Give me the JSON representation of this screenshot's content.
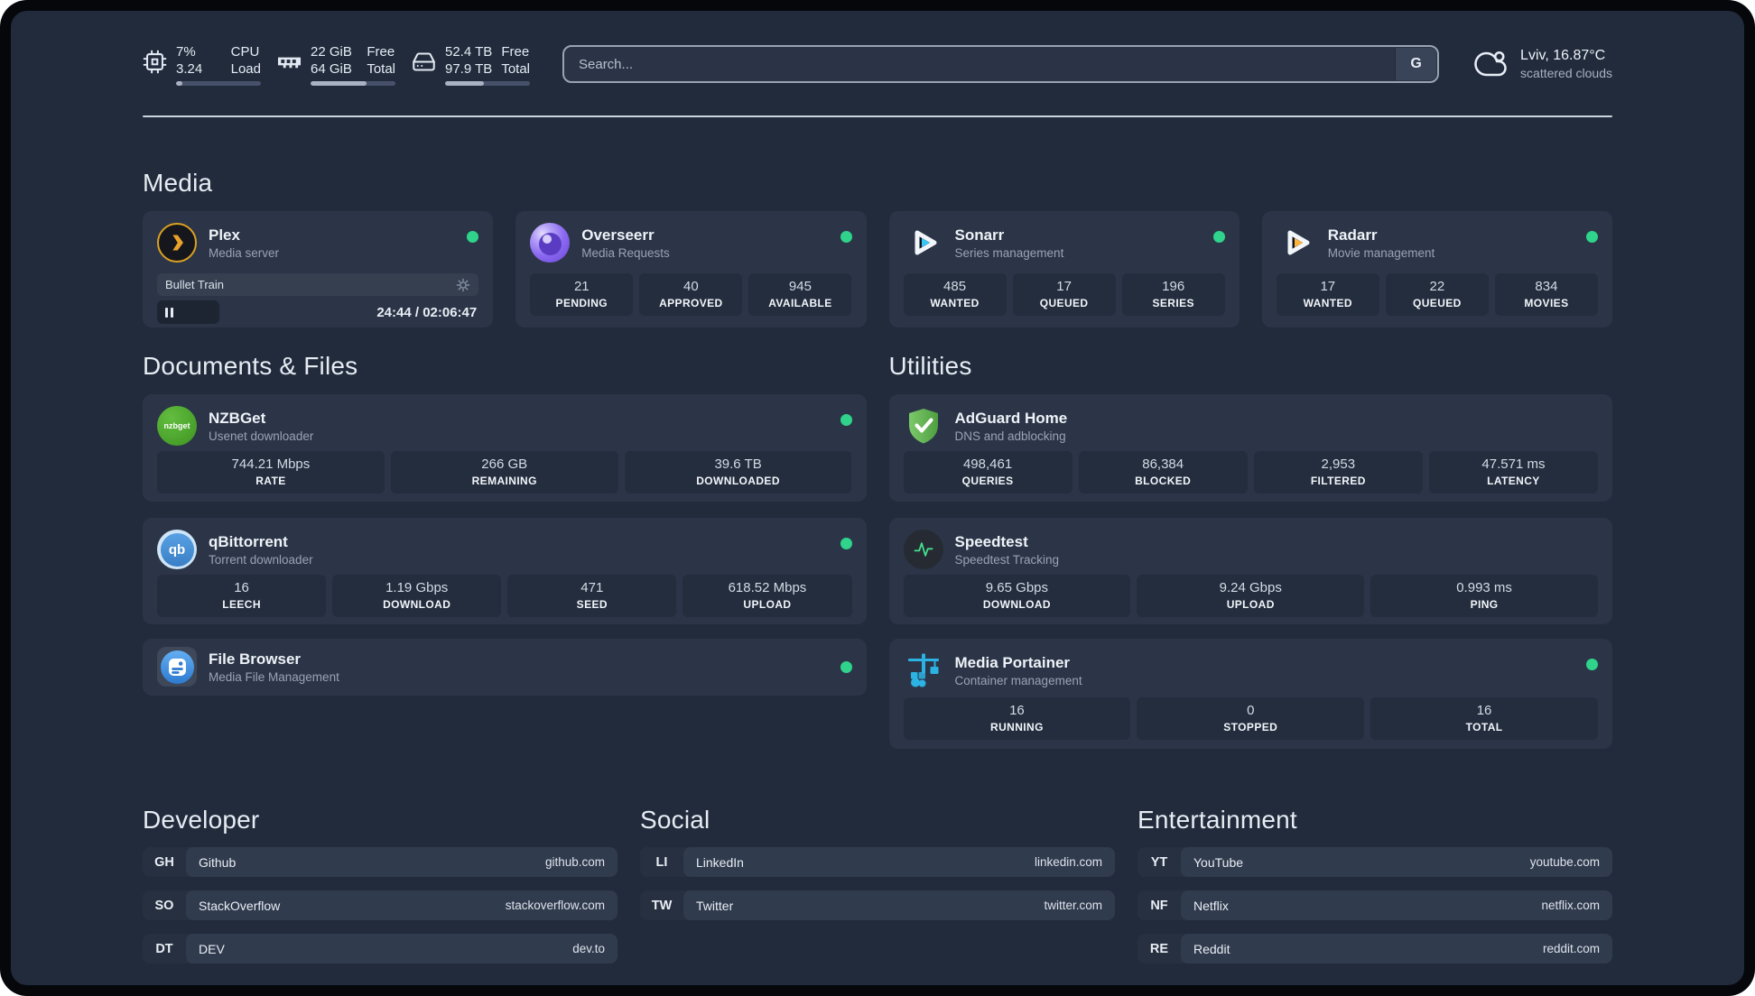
{
  "colors": {
    "status_online_green": "#2fd38b",
    "plex_amber": "#e8a22b",
    "sonarr_cyan": "#38c6f4",
    "radarr_amber": "#ffb53c",
    "adguard_green": "#5fb94f",
    "portainer_cyan": "#2bb3e4",
    "qbittorrent_blue": "#4a90d9",
    "nzbget_green": "#47a133",
    "overseerr_purple": "#8a68f0"
  },
  "header": {
    "stats": [
      {
        "name": "cpu",
        "value_top": "7%",
        "value_bottom": "3.24",
        "label_top": "CPU",
        "label_bottom": "Load",
        "progress_pct": 7
      },
      {
        "name": "memory",
        "value_top": "22 GiB",
        "value_bottom": "64 GiB",
        "label_top": "Free",
        "label_bottom": "Total",
        "progress_pct": 66
      },
      {
        "name": "storage",
        "value_top": "52.4 TB",
        "value_bottom": "97.9 TB",
        "label_top": "Free",
        "label_bottom": "Total",
        "progress_pct": 46
      }
    ],
    "search": {
      "placeholder": "Search...",
      "engine_button": "G"
    },
    "weather": {
      "location_temp": "Lviv, 16.87°C",
      "condition": "scattered clouds"
    }
  },
  "sections": {
    "media": {
      "title": "Media",
      "apps": [
        {
          "name": "Plex",
          "subtitle": "Media server",
          "online": true,
          "now_playing": {
            "title": "Bullet Train",
            "time": "24:44 / 02:06:47",
            "progress_pct": 19.5,
            "state": "paused"
          }
        },
        {
          "name": "Overseerr",
          "subtitle": "Media Requests",
          "online": true,
          "stats": [
            {
              "value": "21",
              "label": "PENDING"
            },
            {
              "value": "40",
              "label": "APPROVED"
            },
            {
              "value": "945",
              "label": "AVAILABLE"
            }
          ]
        },
        {
          "name": "Sonarr",
          "subtitle": "Series management",
          "online": true,
          "stats": [
            {
              "value": "485",
              "label": "WANTED"
            },
            {
              "value": "17",
              "label": "QUEUED"
            },
            {
              "value": "196",
              "label": "SERIES"
            }
          ]
        },
        {
          "name": "Radarr",
          "subtitle": "Movie management",
          "online": true,
          "stats": [
            {
              "value": "17",
              "label": "WANTED"
            },
            {
              "value": "22",
              "label": "QUEUED"
            },
            {
              "value": "834",
              "label": "MOVIES"
            }
          ]
        }
      ]
    },
    "documents": {
      "title": "Documents & Files",
      "apps": [
        {
          "name": "NZBGet",
          "subtitle": "Usenet downloader",
          "online": true,
          "icon_text": "nzbget",
          "stats": [
            {
              "value": "744.21 Mbps",
              "label": "RATE"
            },
            {
              "value": "266 GB",
              "label": "REMAINING"
            },
            {
              "value": "39.6 TB",
              "label": "DOWNLOADED"
            }
          ]
        },
        {
          "name": "qBittorrent",
          "subtitle": "Torrent downloader",
          "online": true,
          "icon_text": "qb",
          "stats": [
            {
              "value": "16",
              "label": "LEECH"
            },
            {
              "value": "1.19 Gbps",
              "label": "DOWNLOAD"
            },
            {
              "value": "471",
              "label": "SEED"
            },
            {
              "value": "618.52 Mbps",
              "label": "UPLOAD"
            }
          ]
        },
        {
          "name": "File Browser",
          "subtitle": "Media File Management",
          "online": true,
          "stats": []
        }
      ]
    },
    "utilities": {
      "title": "Utilities",
      "apps": [
        {
          "name": "AdGuard Home",
          "subtitle": "DNS and adblocking",
          "stats": [
            {
              "value": "498,461",
              "label": "QUERIES"
            },
            {
              "value": "86,384",
              "label": "BLOCKED"
            },
            {
              "value": "2,953",
              "label": "FILTERED"
            },
            {
              "value": "47.571 ms",
              "label": "LATENCY"
            }
          ]
        },
        {
          "name": "Speedtest",
          "subtitle": "Speedtest Tracking",
          "stats": [
            {
              "value": "9.65 Gbps",
              "label": "DOWNLOAD"
            },
            {
              "value": "9.24 Gbps",
              "label": "UPLOAD"
            },
            {
              "value": "0.993 ms",
              "label": "PING"
            }
          ]
        },
        {
          "name": "Media Portainer",
          "subtitle": "Container management",
          "online": true,
          "stats": [
            {
              "value": "16",
              "label": "RUNNING"
            },
            {
              "value": "0",
              "label": "STOPPED"
            },
            {
              "value": "16",
              "label": "TOTAL"
            }
          ]
        }
      ]
    },
    "link_groups": [
      {
        "title": "Developer",
        "items": [
          {
            "abbr": "GH",
            "name": "Github",
            "url": "github.com"
          },
          {
            "abbr": "SO",
            "name": "StackOverflow",
            "url": "stackoverflow.com"
          },
          {
            "abbr": "DT",
            "name": "DEV",
            "url": "dev.to"
          }
        ]
      },
      {
        "title": "Social",
        "items": [
          {
            "abbr": "LI",
            "name": "LinkedIn",
            "url": "linkedin.com"
          },
          {
            "abbr": "TW",
            "name": "Twitter",
            "url": "twitter.com"
          }
        ]
      },
      {
        "title": "Entertainment",
        "items": [
          {
            "abbr": "YT",
            "name": "YouTube",
            "url": "youtube.com"
          },
          {
            "abbr": "NF",
            "name": "Netflix",
            "url": "netflix.com"
          },
          {
            "abbr": "RE",
            "name": "Reddit",
            "url": "reddit.com"
          }
        ]
      }
    ]
  }
}
